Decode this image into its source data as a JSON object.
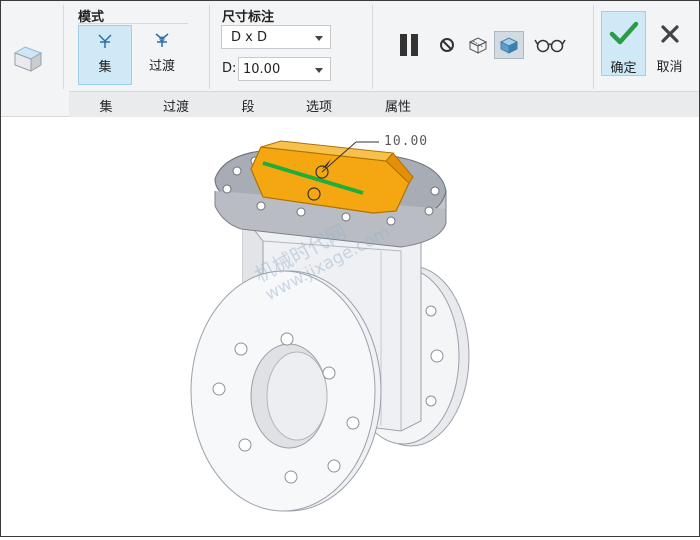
{
  "mode_group": {
    "title": "模式",
    "buttons": [
      {
        "label": "集",
        "active": true
      },
      {
        "label": "过渡",
        "active": false
      }
    ]
  },
  "dimension_group": {
    "title": "尺寸标注",
    "type_value": "D x D",
    "d_label": "D:",
    "d_value": "10.00"
  },
  "tools": {
    "pause": "pause-icon",
    "stop": "no-entry-icon",
    "preview_wire": "wireframe-preview-icon",
    "preview_shaded": "shaded-preview-icon",
    "verify": "glasses-icon"
  },
  "actions": {
    "ok_label": "确定",
    "cancel_label": "取消"
  },
  "tabs": [
    "集",
    "过渡",
    "段",
    "选项",
    "属性"
  ],
  "model": {
    "dimension_text": "10.00"
  },
  "watermark": {
    "line1": "机械时代网",
    "line2": "www.jixage.com"
  },
  "colors": {
    "accent": "#cfe9f7",
    "ok_check": "#2a9b46",
    "selection_fill": "#f5a712",
    "selection_line": "#1fae3b"
  }
}
